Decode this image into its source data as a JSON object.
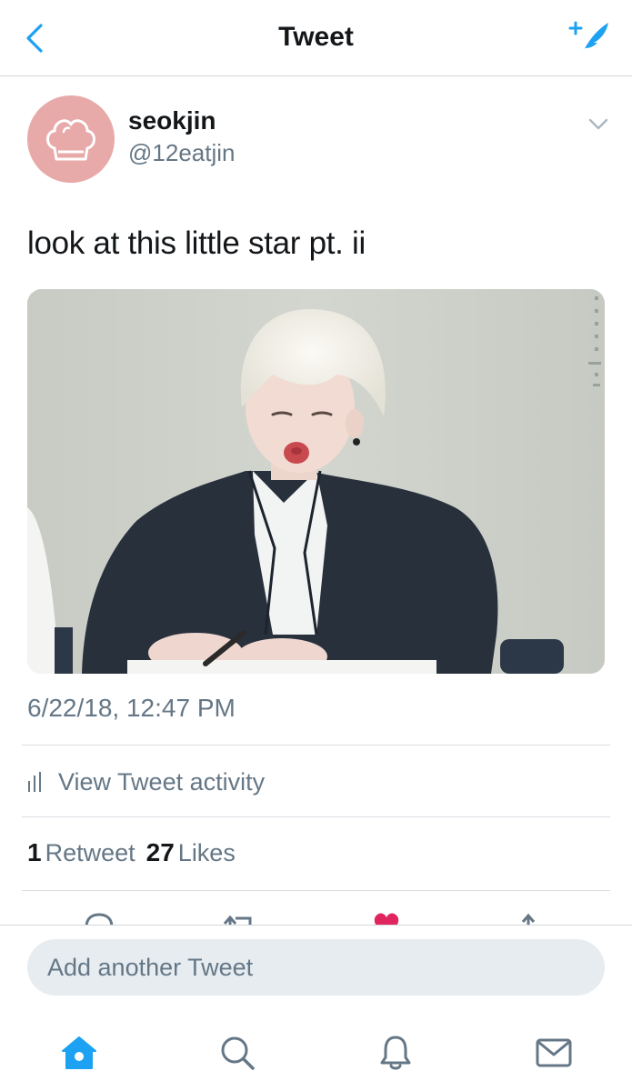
{
  "nav": {
    "title": "Tweet",
    "back_icon": "chevron-left-icon",
    "compose_icon": "compose-tweet-icon",
    "accent": "#1da1f2"
  },
  "tweet": {
    "author": {
      "display_name": "seokjin",
      "handle": "@12eatjin",
      "avatar_icon": "chef-hat-icon",
      "avatar_color": "#e8a9a9"
    },
    "text": "look at this little star pt. ii",
    "timestamp": "6/22/18, 12:47 PM",
    "activity_label": "View Tweet activity",
    "stats": {
      "retweets": "1",
      "retweets_label": "Retweet",
      "likes": "27",
      "likes_label": "Likes"
    },
    "actions": [
      "reply-icon",
      "retweet-icon",
      "like-icon",
      "share-icon"
    ],
    "liked_color": "#e0245e"
  },
  "reply": {
    "placeholder": "Add another Tweet"
  },
  "tabs": [
    {
      "name": "home",
      "icon": "home-icon",
      "active": true
    },
    {
      "name": "search",
      "icon": "search-icon",
      "active": false
    },
    {
      "name": "notifications",
      "icon": "bell-icon",
      "active": false
    },
    {
      "name": "messages",
      "icon": "mail-icon",
      "active": false
    }
  ]
}
